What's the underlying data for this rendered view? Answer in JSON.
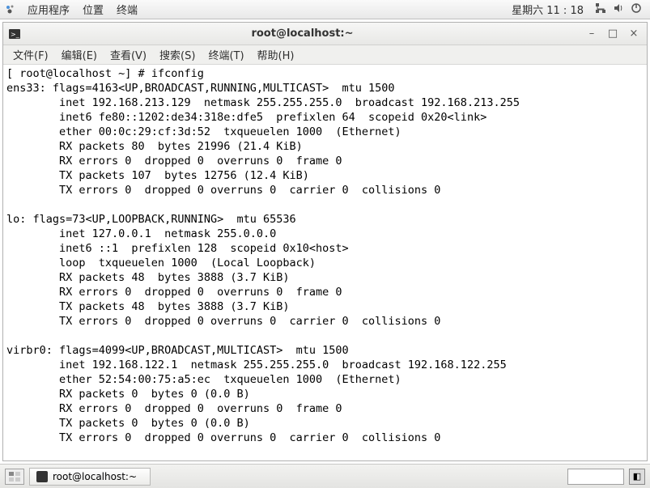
{
  "top_panel": {
    "app": "应用程序",
    "places": "位置",
    "terminal": "终端",
    "clock": "星期六 11 : 18"
  },
  "window": {
    "title": "root@localhost:~"
  },
  "menubar": {
    "file": "文件(F)",
    "edit": "编辑(E)",
    "view": "查看(V)",
    "search": "搜索(S)",
    "terminal": "终端(T)",
    "help": "帮助(H)"
  },
  "terminal": {
    "prompt": "[ root@localhost ~] # ",
    "command": "ifconfig",
    "output": "ens33: flags=4163<UP,BROADCAST,RUNNING,MULTICAST>  mtu 1500\n        inet 192.168.213.129  netmask 255.255.255.0  broadcast 192.168.213.255\n        inet6 fe80::1202:de34:318e:dfe5  prefixlen 64  scopeid 0x20<link>\n        ether 00:0c:29:cf:3d:52  txqueuelen 1000  (Ethernet)\n        RX packets 80  bytes 21996 (21.4 KiB)\n        RX errors 0  dropped 0  overruns 0  frame 0\n        TX packets 107  bytes 12756 (12.4 KiB)\n        TX errors 0  dropped 0 overruns 0  carrier 0  collisions 0\n\nlo: flags=73<UP,LOOPBACK,RUNNING>  mtu 65536\n        inet 127.0.0.1  netmask 255.0.0.0\n        inet6 ::1  prefixlen 128  scopeid 0x10<host>\n        loop  txqueuelen 1000  (Local Loopback)\n        RX packets 48  bytes 3888 (3.7 KiB)\n        RX errors 0  dropped 0  overruns 0  frame 0\n        TX packets 48  bytes 3888 (3.7 KiB)\n        TX errors 0  dropped 0 overruns 0  carrier 0  collisions 0\n\nvirbr0: flags=4099<UP,BROADCAST,MULTICAST>  mtu 1500\n        inet 192.168.122.1  netmask 255.255.255.0  broadcast 192.168.122.255\n        ether 52:54:00:75:a5:ec  txqueuelen 1000  (Ethernet)\n        RX packets 0  bytes 0 (0.0 B)\n        RX errors 0  dropped 0  overruns 0  frame 0\n        TX packets 0  bytes 0 (0.0 B)\n        TX errors 0  dropped 0 overruns 0  carrier 0  collisions 0"
  },
  "taskbar": {
    "task_label": "root@localhost:~"
  }
}
